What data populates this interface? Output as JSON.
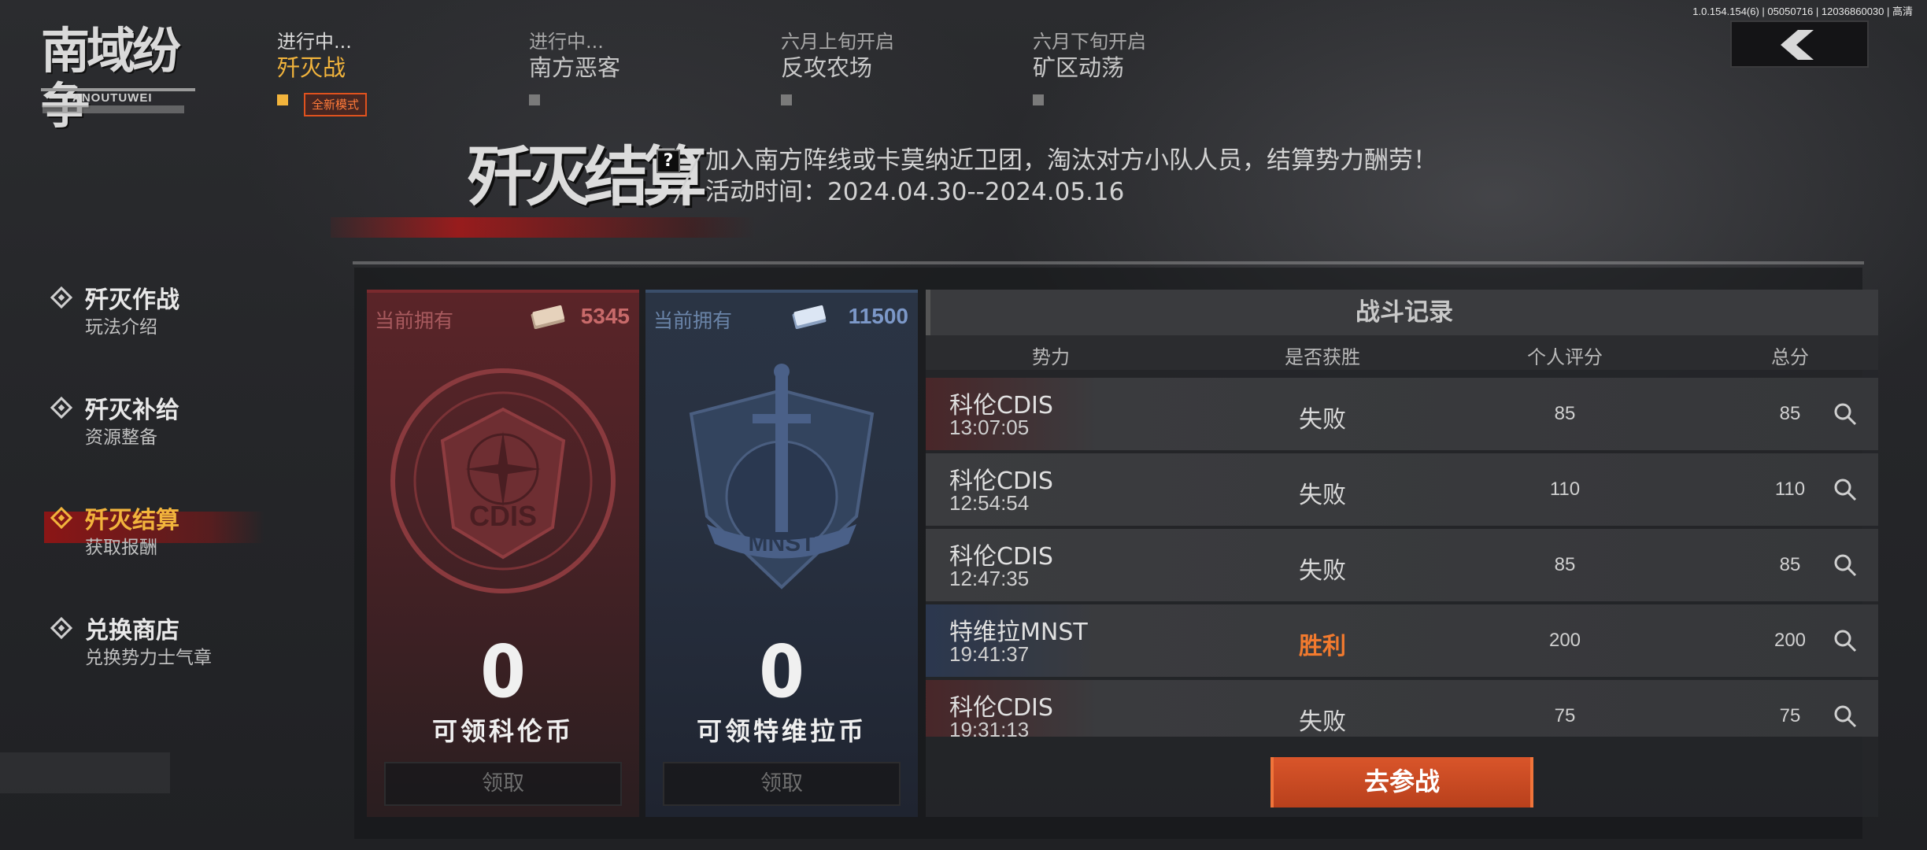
{
  "build_info": "1.0.154.154(6) | 05050716 | 12036860030 | 高清",
  "logo": {
    "title": "南域纷争",
    "subtitle": "ANOUTUWEI"
  },
  "tabs": [
    {
      "status": "进行中...",
      "name": "歼灭战",
      "active": true
    },
    {
      "status": "进行中...",
      "name": "南方恶客",
      "active": false
    },
    {
      "status": "六月上旬开启",
      "name": "反攻农场",
      "active": false
    },
    {
      "status": "六月下旬开启",
      "name": "矿区动荡",
      "active": false
    }
  ],
  "new_badge": "全新模式",
  "header": {
    "title": "歼灭结算",
    "help": "?",
    "description": "加入南方阵线或卡莫纳近卫团，淘汰对方小队人员，结算势力酬劳！",
    "event_time": "活动时间：2024.04.30--2024.05.16"
  },
  "nav": [
    {
      "title": "歼灭作战",
      "subtitle": "玩法介绍",
      "active": false
    },
    {
      "title": "歼灭补给",
      "subtitle": "资源整备",
      "active": false
    },
    {
      "title": "歼灭结算",
      "subtitle": "获取报酬",
      "active": true
    },
    {
      "title": "兑换商店",
      "subtitle": "兑换势力士气章",
      "active": false
    }
  ],
  "cards": [
    {
      "owned_label": "当前拥有",
      "amount": "5345",
      "emblem": "CDIS",
      "count": "0",
      "label": "可领科伦币",
      "button": "领取",
      "color": "#5a2428"
    },
    {
      "owned_label": "当前拥有",
      "amount": "11500",
      "emblem": "MNST",
      "count": "0",
      "label": "可领特维拉币",
      "button": "领取",
      "color": "#2a3444"
    }
  ],
  "record": {
    "title": "战斗记录",
    "columns": [
      "势力",
      "是否获胜",
      "个人评分",
      "总分"
    ],
    "rows": [
      {
        "faction": "科伦CDIS",
        "time": "13:07:05",
        "result": "失败",
        "win": false,
        "personal": "85",
        "total": "85"
      },
      {
        "faction": "科伦CDIS",
        "time": "12:54:54",
        "result": "失败",
        "win": false,
        "personal": "110",
        "total": "110"
      },
      {
        "faction": "科伦CDIS",
        "time": "12:47:35",
        "result": "失败",
        "win": false,
        "personal": "85",
        "total": "85"
      },
      {
        "faction": "特维拉MNST",
        "time": "19:41:37",
        "result": "胜利",
        "win": true,
        "personal": "200",
        "total": "200"
      },
      {
        "faction": "科伦CDIS",
        "time": "19:31:13",
        "result": "失败",
        "win": false,
        "personal": "75",
        "total": "75"
      }
    ]
  },
  "join_button": "去参战",
  "colors": {
    "accent_gold": "#f2b43c",
    "accent_orange": "#d9552a",
    "win": "#f27a2e"
  }
}
